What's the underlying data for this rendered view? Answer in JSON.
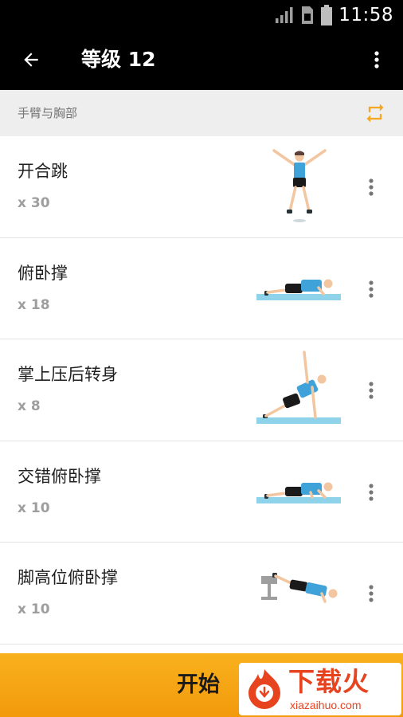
{
  "status_bar": {
    "time": "11:58"
  },
  "app_bar": {
    "title": "等级 12"
  },
  "section": {
    "label": "手臂与胸部"
  },
  "exercises": [
    {
      "name": "开合跳",
      "count": "x 30"
    },
    {
      "name": "俯卧撑",
      "count": "x 18"
    },
    {
      "name": "掌上压后转身",
      "count": "x 8"
    },
    {
      "name": "交错俯卧撑",
      "count": "x 10"
    },
    {
      "name": "脚高位俯卧撑",
      "count": "x 10"
    }
  ],
  "start_button": {
    "label": "开始"
  },
  "watermark": {
    "title": "下载火",
    "subtitle": "xiazaihuo.com"
  },
  "colors": {
    "accent": "#f5a623",
    "toolbar": "#000000",
    "header_bg": "#eeeeee"
  }
}
